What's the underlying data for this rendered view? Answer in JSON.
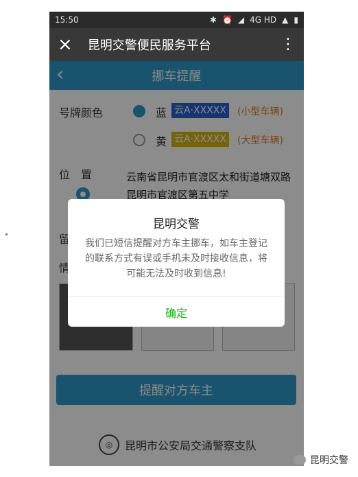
{
  "statusbar": {
    "time": "15:50",
    "network": "4G HD"
  },
  "wechat": {
    "title": "昆明交警便民服务平台",
    "close_icon": "×",
    "more_icon": "⋮"
  },
  "header": {
    "title": "挪车提醒",
    "back_icon": "‹"
  },
  "form": {
    "plate_color_label": "号牌颜色",
    "blue": {
      "char": "蓝",
      "plate": "云A·XXXXX",
      "note": "(小型车辆)"
    },
    "yellow": {
      "char": "黄",
      "plate": "云A·XXXXX",
      "note": "(大型车辆)"
    },
    "location_label": "位　置",
    "address": "云南省昆明市官渡区太和街道塘双路昆明市官渡区第五中学",
    "leave_label": "留",
    "info_label": "情",
    "remind_button": "提醒对方车主"
  },
  "footer": {
    "org": "昆明市公安局交通警察支队"
  },
  "dialog": {
    "title": "昆明交警",
    "message": "我们已短信提醒对方车主挪车，如车主登记的联系方式有误或手机未及时接收信息，将可能无法及时收到信息!",
    "confirm": "确定"
  },
  "watermark": {
    "text": "昆明交警"
  },
  "colors": {
    "accent": "#2f97c6",
    "confirm": "#1aad19",
    "plate_blue": "#2a5fd1",
    "plate_yellow": "#d8b21b"
  }
}
